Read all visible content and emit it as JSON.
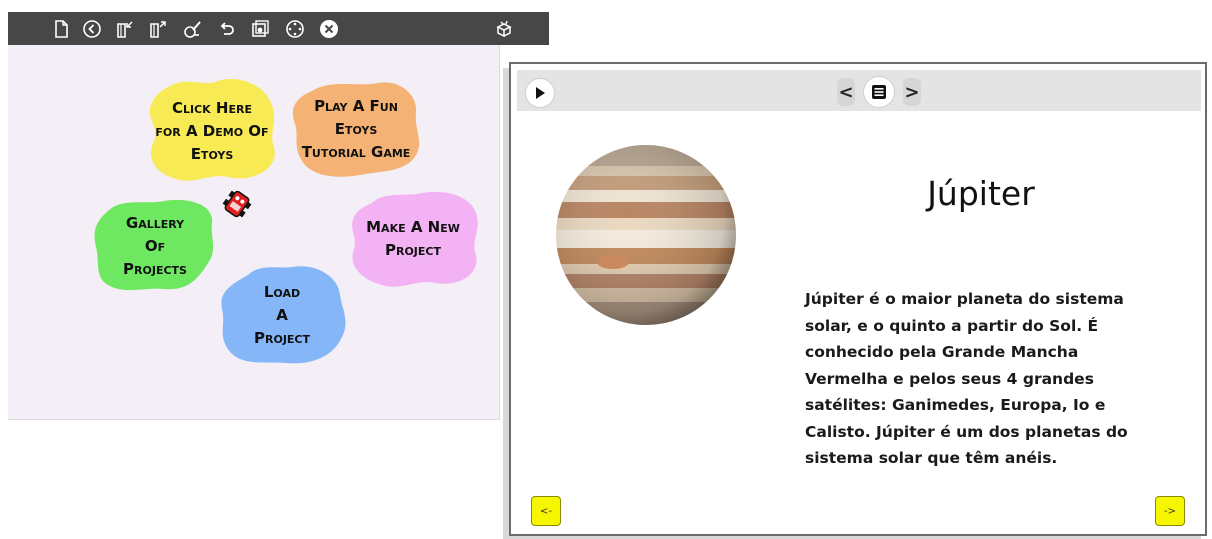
{
  "etoys": {
    "toolbar": {
      "icons": [
        "new-page-icon",
        "back-circle-icon",
        "import-project-icon",
        "export-project-icon",
        "paint-brush-icon",
        "undo-icon",
        "supplies-icon",
        "navigator-icon",
        "close-circle-icon",
        "objects-bin-icon"
      ]
    },
    "canvas_color": "#f4eef6",
    "bubbles": [
      {
        "id": "demo",
        "label": "Click Here\nfor A Demo Of\nEtoys",
        "color": "#f8ea55"
      },
      {
        "id": "tutorial",
        "label": "Play A Fun\nEtoys\nTutorial Game",
        "color": "#f4b274"
      },
      {
        "id": "gallery",
        "label": "Gallery\nOf\nProjects",
        "color": "#6ee860"
      },
      {
        "id": "new",
        "label": "Make A New\nProject",
        "color": "#f2b2f4"
      },
      {
        "id": "load",
        "label": "Load\nA\nProject",
        "color": "#84b6f8"
      }
    ]
  },
  "book": {
    "toolbar": {
      "play_icon": "play-icon",
      "prev_label": "<",
      "next_label": ">",
      "menu_icon": "menu-icon"
    },
    "page": {
      "title": "Júpiter",
      "text": "Júpiter é o maior planeta do sistema solar, e o quinto a partir do Sol. É conhecido pela Grande Mancha Vermelha e pelos seus 4 grandes satélites: Ganimedes, Europa, Io e Calisto. Júpiter é um dos planetas do sistema solar que têm anéis.",
      "image": "jupiter-planet-image"
    },
    "footer": {
      "prev_label": "<-",
      "next_label": "->"
    },
    "accent_color": "#f6f600"
  }
}
